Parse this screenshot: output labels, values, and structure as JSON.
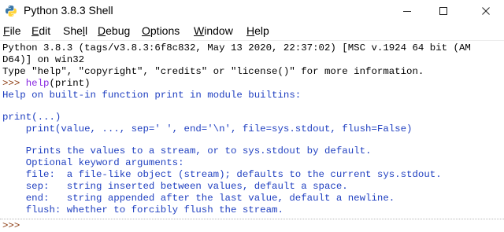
{
  "window": {
    "title": "Python 3.8.3 Shell",
    "icon": "python-icon",
    "controls": [
      "minimize-icon",
      "maximize-icon",
      "close-icon"
    ]
  },
  "menu": [
    {
      "pre": "",
      "key": "F",
      "post": "ile"
    },
    {
      "pre": "",
      "key": "E",
      "post": "dit"
    },
    {
      "pre": "She",
      "key": "l",
      "post": "l"
    },
    {
      "pre": "",
      "key": "D",
      "post": "ebug"
    },
    {
      "pre": "",
      "key": "O",
      "post": "ptions"
    },
    {
      "pre": "",
      "key": "W",
      "post": "indow"
    },
    {
      "pre": "",
      "key": "H",
      "post": "elp"
    }
  ],
  "shell": {
    "banner": [
      "Python 3.8.3 (tags/v3.8.3:6f8c832, May 13 2020, 22:37:02) [MSC v.1924 64 bit (AM",
      "D64)] on win32",
      "Type \"help\", \"copyright\", \"credits\" or \"license()\" for more information."
    ],
    "prompt": ">>> ",
    "command_func": "help",
    "command_args": "(print)",
    "output": [
      "Help on built-in function print in module builtins:",
      "",
      "print(...)",
      "    print(value, ..., sep=' ', end='\\n', file=sys.stdout, flush=False)",
      "",
      "    Prints the values to a stream, or to sys.stdout by default.",
      "    Optional keyword arguments:",
      "    file:  a file-like object (stream); defaults to the current sys.stdout.",
      "    sep:   string inserted between values, default a space.",
      "    end:   string appended after the last value, default a newline.",
      "    flush: whether to forcibly flush the stream."
    ],
    "final_prompt": ">>> "
  },
  "colors": {
    "output": "#1f3fc0",
    "builtin": "#8a2be2",
    "prompt": "#8b3a0f"
  }
}
